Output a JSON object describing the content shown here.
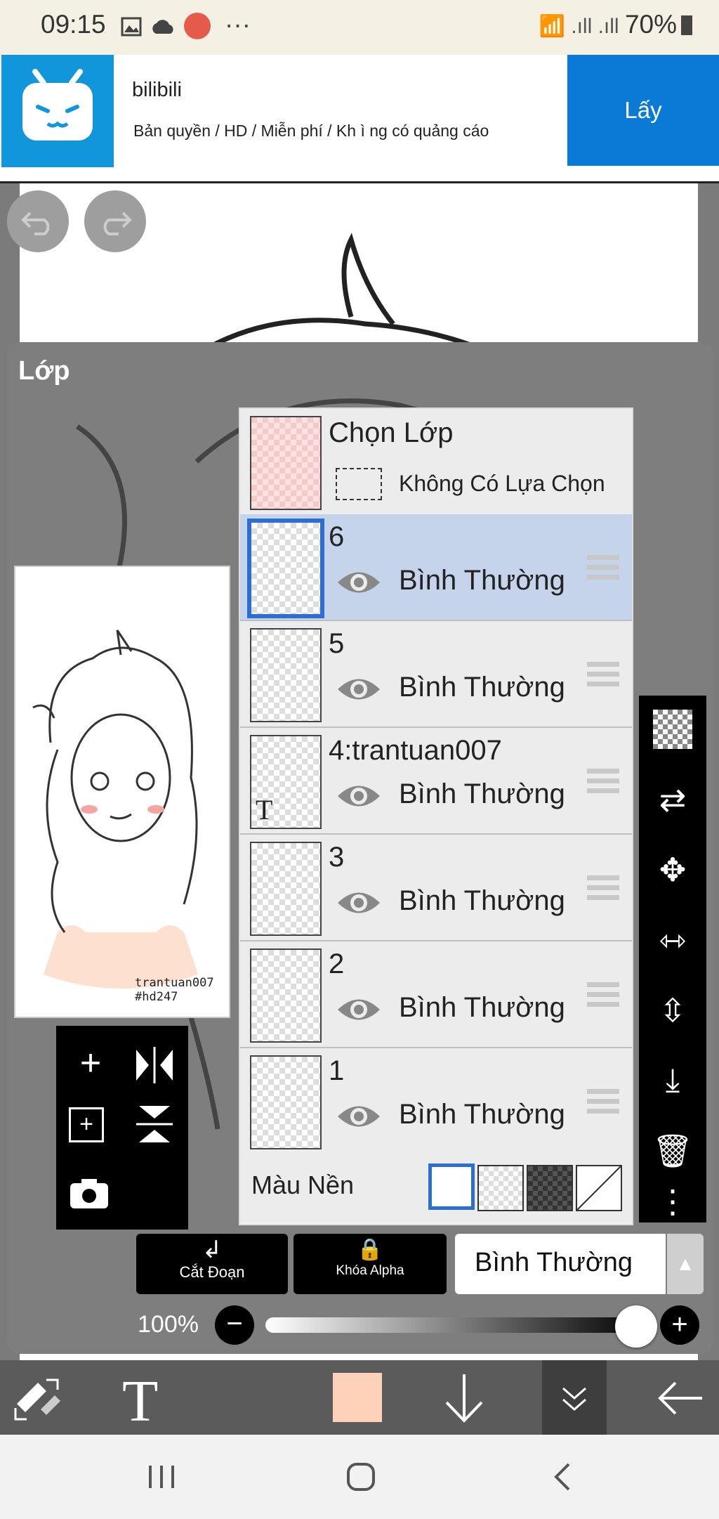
{
  "status": {
    "time": "09:15",
    "battery": "70%"
  },
  "ad": {
    "title": "bilibili",
    "subtitle": "Bản quyền / HD / Miễn phí / Kh ì ng có quảng cáo",
    "cta": "Lấy"
  },
  "panel": {
    "title": "Lớp"
  },
  "selection": {
    "title": "Chọn Lớp",
    "none": "Không Có Lựa Chọn"
  },
  "layers": [
    {
      "name": "6",
      "mode": "Bình Thường",
      "selected": true
    },
    {
      "name": "5",
      "mode": "Bình Thường",
      "selected": false
    },
    {
      "name": "4:trantuan007",
      "mode": "Bình Thường",
      "selected": false,
      "text_layer": true
    },
    {
      "name": "3",
      "mode": "Bình Thường",
      "selected": false
    },
    {
      "name": "2",
      "mode": "Bình Thường",
      "selected": false
    },
    {
      "name": "1",
      "mode": "Bình Thường",
      "selected": false
    }
  ],
  "background": {
    "label": "Màu Nền"
  },
  "buttons": {
    "clip": "Cắt Đoạn",
    "alpha_lock": "Khóa Alpha",
    "blend_mode": "Bình Thường"
  },
  "opacity": {
    "label": "100%",
    "level": 1.0
  },
  "preview_signature": {
    "line1": "trantuan007",
    "line2": "#hd247"
  },
  "colors": {
    "accent": "#2c6fd1",
    "current_color": "#fdd2b8",
    "ad_blue": "#0b7ad6"
  }
}
